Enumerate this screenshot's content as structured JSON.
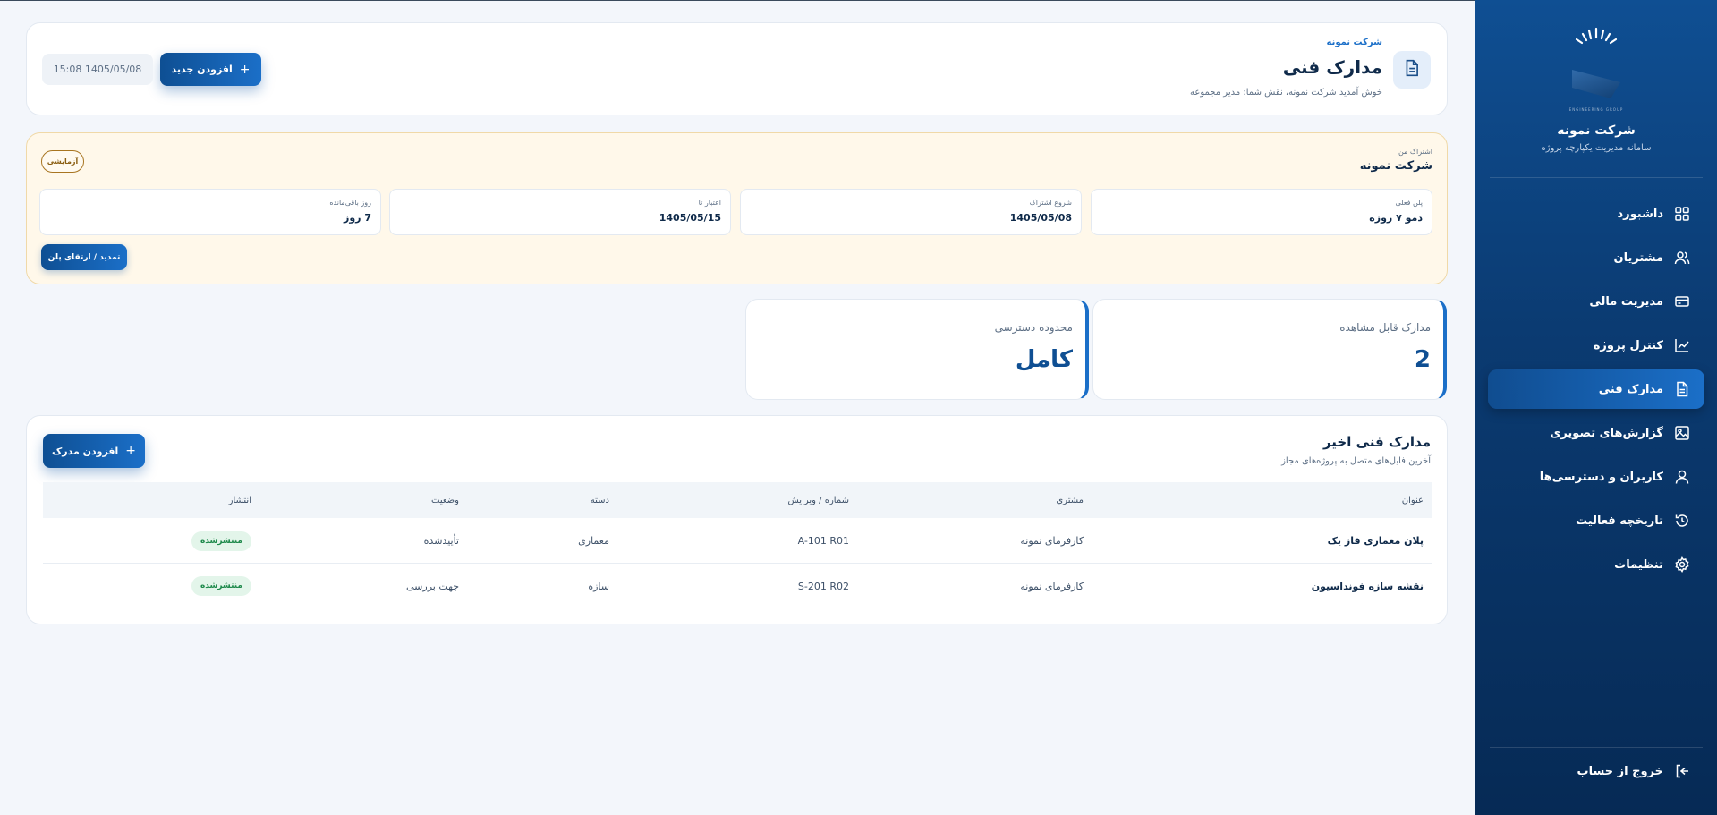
{
  "sidebar": {
    "brand_tagline": "ENGINEERING GROUP",
    "company": "شرکت نمونه",
    "system_name": "سامانه مدیریت یکپارچه پروژه",
    "items": [
      {
        "label": "داشبورد",
        "icon": "grid-icon"
      },
      {
        "label": "مشتریان",
        "icon": "users-icon"
      },
      {
        "label": "مدیریت مالی",
        "icon": "credit-card-icon"
      },
      {
        "label": "کنترل پروژه",
        "icon": "chart-line-icon"
      },
      {
        "label": "مدارک فنی",
        "icon": "document-icon",
        "active": true
      },
      {
        "label": "گزارش‌های تصویری",
        "icon": "image-icon"
      },
      {
        "label": "کاربران و دسترسی‌ها",
        "icon": "user-icon"
      },
      {
        "label": "تاریخچه فعالیت",
        "icon": "history-icon"
      },
      {
        "label": "تنظیمات",
        "icon": "gear-icon"
      }
    ],
    "logout": "خروج از حساب"
  },
  "header": {
    "company": "شرکت نمونه",
    "title": "مدارک فنی",
    "welcome": "خوش آمدید شرکت نمونه، نقش شما: مدیر مجموعه",
    "add_new": "افزودن جدید",
    "datetime": "15:08 1405/05/08"
  },
  "subscription": {
    "label": "اشتراک من",
    "company": "شرکت نمونه",
    "badge": "آزمایشی",
    "stats": [
      {
        "label": "پلن فعلی",
        "value": "دمو ۷ روزه"
      },
      {
        "label": "شروع اشتراک",
        "value": "1405/05/08"
      },
      {
        "label": "اعتبار تا",
        "value": "1405/05/15"
      },
      {
        "label": "روز باقی‌مانده",
        "value": "7 روز"
      }
    ],
    "renew_button": "تمدید / ارتقای پلن"
  },
  "metrics": [
    {
      "label": "مدارک قابل مشاهده",
      "value": "2"
    },
    {
      "label": "محدوده دسترسی",
      "value": "کامل"
    }
  ],
  "recent": {
    "title": "مدارک فنی اخیر",
    "subtitle": "آخرین فایل‌های متصل به پروژه‌های مجاز",
    "add_button": "افزودن مدرک",
    "columns": [
      "عنوان",
      "مشتری",
      "شماره / ویرایش",
      "دسته",
      "وضعیت",
      "انتشار"
    ],
    "rows": [
      {
        "title": "پلان معماری فاز یک",
        "client": "کارفرمای نمونه",
        "number": "A-101 R01",
        "category": "معماری",
        "status": "تأییدشده",
        "publish": "منتشرشده"
      },
      {
        "title": "نقشه سازه فونداسیون",
        "client": "کارفرمای نمونه",
        "number": "S-201 R02",
        "category": "سازه",
        "status": "جهت بررسی",
        "publish": "منتشرشده"
      }
    ]
  },
  "colors": {
    "accent": "#1b6fc8",
    "sidebar_dark": "#062a55",
    "trial_bg": "#fff8ea",
    "published_green": "#1f8a4c"
  }
}
